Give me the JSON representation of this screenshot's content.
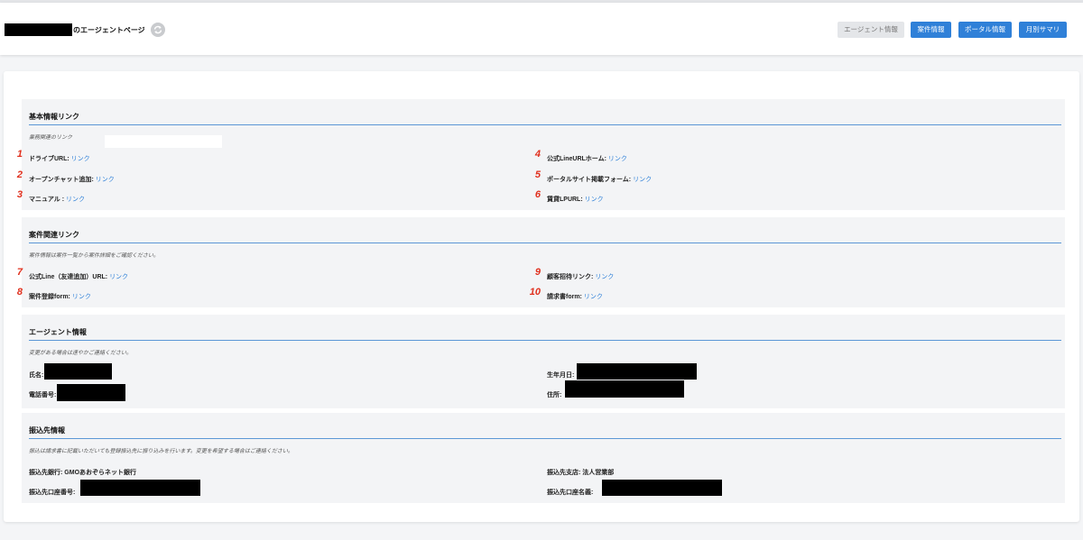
{
  "header": {
    "title_suffix": "のエージェントページ",
    "buttons": [
      "エージェント情報",
      "案件情報",
      "ポータル情報",
      "月別サマリ"
    ]
  },
  "basic": {
    "title": "基本情報リンク",
    "desc": "業務関連のリンク",
    "rows": [
      {
        "num": "1",
        "label": "ドライブURL:",
        "link": "リンク"
      },
      {
        "num": "2",
        "label": "オープンチャット追加:",
        "link": "リンク"
      },
      {
        "num": "3",
        "label": "マニュアル :",
        "link": "リンク"
      },
      {
        "num": "4",
        "label": "公式LineURLホーム:",
        "link": "リンク"
      },
      {
        "num": "5",
        "label": "ポータルサイト掲載フォーム:",
        "link": "リンク"
      },
      {
        "num": "6",
        "label": "賃貸LPURL:",
        "link": "リンク"
      }
    ]
  },
  "project": {
    "title": "案件関連リンク",
    "desc": "案件情報は案件一覧から案件詳細をご確認ください。",
    "rows": [
      {
        "num": "7",
        "label": "公式Line（友達追加）URL:",
        "link": "リンク"
      },
      {
        "num": "8",
        "label": "案件登録form:",
        "link": "リンク"
      },
      {
        "num": "9",
        "label": "顧客招待リンク:",
        "link": "リンク"
      },
      {
        "num": "10",
        "label": "請求書form:",
        "link": "リンク"
      }
    ]
  },
  "agent": {
    "title": "エージェント情報",
    "desc": "変更がある場合は速やかご連絡ください。",
    "fields": [
      "氏名:",
      "電話番号:",
      "生年月日:",
      "住所:"
    ]
  },
  "bank": {
    "title": "振込先情報",
    "desc": "振込は請求書に記載いただいても登録振込先に振り込みを行います。変更を希望する場合はご連絡ください。",
    "bank_label": "振込先銀行:",
    "bank_value": "GMOあおぞらネット銀行",
    "branch_label": "振込先支店:",
    "branch_value": "法人営業部",
    "account_no_label": "振込先口座番号:",
    "account_name_label": "振込先口座名義:"
  },
  "colors": {
    "accent": "#2f80d8",
    "number": "#e0301e"
  }
}
